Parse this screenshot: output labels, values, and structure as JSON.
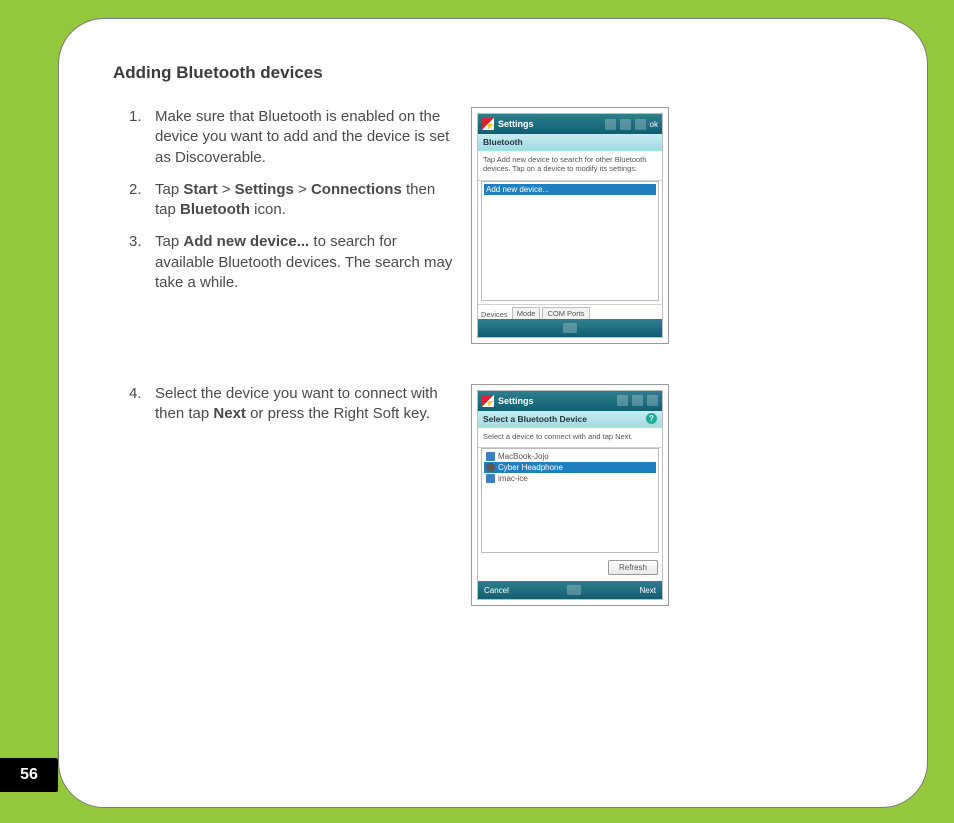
{
  "page_number": "56",
  "title": "Adding Bluetooth devices",
  "blockA": {
    "steps": [
      {
        "pre": "Make sure that Bluetooth is enabled on the device you want to add and the device is set as Discoverable."
      },
      {
        "pre": "Tap ",
        "b1": "Start",
        "g1": " > ",
        "b2": "Settings",
        "g2": " > ",
        "b3": "Connections",
        "post1": " then tap ",
        "b4": "Bluetooth",
        "post2": " icon."
      },
      {
        "pre": "Tap ",
        "b1": "Add new device...",
        "post": " to search for available Bluetooth devices. The search may take a while."
      }
    ],
    "shot": {
      "title": "Settings",
      "sub": "Bluetooth",
      "hint": "Tap Add new device to search for other Bluetooth devices. Tap on a device to modify its settings.",
      "highlight": "Add new device...",
      "tabs_label": "Devices",
      "tabs": [
        "Mode",
        "COM Ports"
      ],
      "ok": "ok"
    }
  },
  "blockB": {
    "start": 4,
    "steps": [
      {
        "pre": "Select the device you want to connect with then tap ",
        "b1": "Next",
        "post": " or press the Right Soft key."
      }
    ],
    "shot": {
      "title": "Settings",
      "sub": "Select a Bluetooth Device",
      "help": "?",
      "hint": "Select a device to connect with and tap Next.",
      "items": [
        "MacBook-Jojo",
        "Cyber Headphone",
        "imac-ice"
      ],
      "selected_index": 1,
      "refresh": "Refresh",
      "left": "Cancel",
      "right": "Next"
    }
  }
}
